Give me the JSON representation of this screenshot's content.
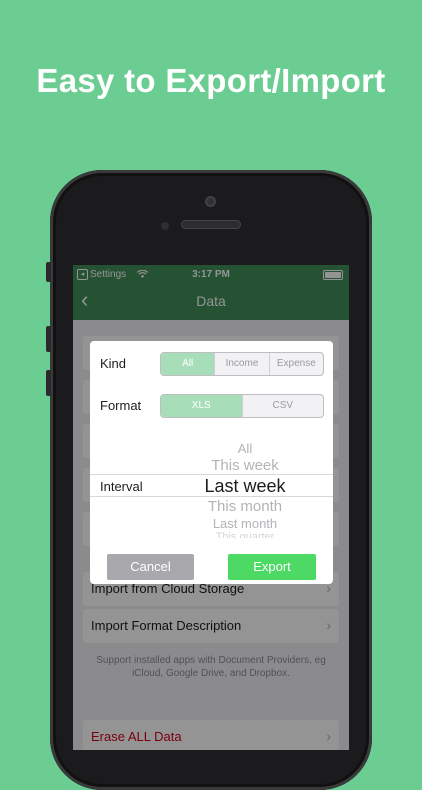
{
  "headline": "Easy to Export/Import",
  "statusbar": {
    "carrier": "Settings",
    "time": "3:17 PM"
  },
  "navbar": {
    "title": "Data",
    "back": "back"
  },
  "list": {
    "import_cloud": "Import from Cloud Storage",
    "import_format": "Import Format Description",
    "footnote": "Support installed apps with Document Providers, eg iCloud, Google Drive, and Dropbox.",
    "erase": "Erase ALL Data"
  },
  "dialog": {
    "kind_label": "Kind",
    "kind_options": [
      "All",
      "Income",
      "Expense"
    ],
    "kind_selected": "All",
    "format_label": "Format",
    "format_options": [
      "XLS",
      "CSV"
    ],
    "format_selected": "XLS",
    "interval_label": "Interval",
    "interval_options": [
      "All",
      "This week",
      "Last week",
      "This month",
      "Last month",
      "This quarter"
    ],
    "interval_selected": "Last week",
    "cancel": "Cancel",
    "export": "Export"
  },
  "colors": {
    "background": "#6ccd93",
    "navbar": "#3e8d59",
    "accent": "#4cd964",
    "selected_segment": "#a8ddb9",
    "destructive": "#d0021b"
  }
}
